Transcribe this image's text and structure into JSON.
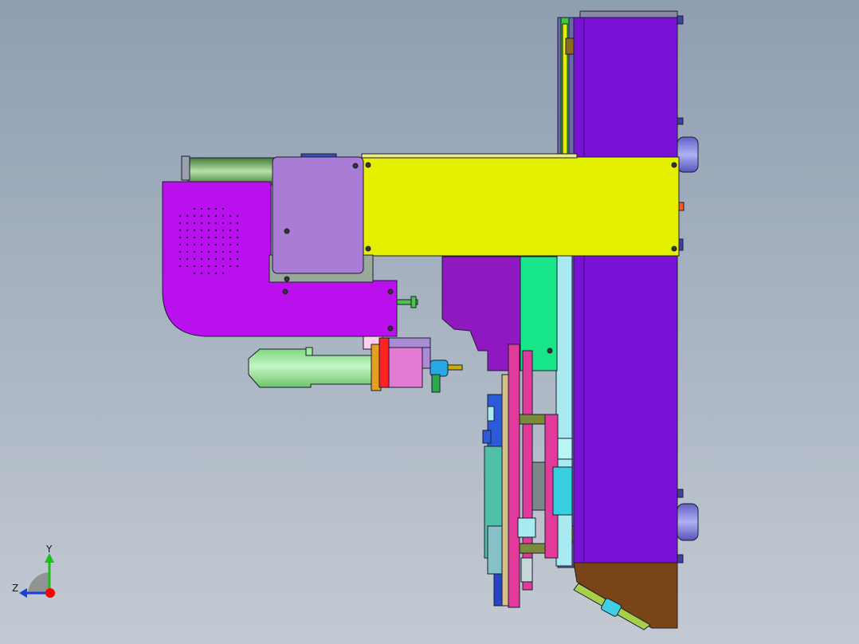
{
  "scene": {
    "background_top": "#8e9eb1",
    "background_bottom": "#c3cad3",
    "outline_color": "#1c1c30"
  },
  "parts": {
    "frame_color": "#7a12d6",
    "base_color": "#7a4516",
    "arm_color": "#e4f000",
    "head_color": "#bb10ee",
    "motor_color": "#a97cd6",
    "barrel_color": "#9cec9c",
    "green_plate_color": "#18e68a",
    "pink_plate_color": "#e23a9a",
    "cyan_color": "#a8eaf0",
    "blue_knob_color": "#8585e0",
    "red_color": "#ff2222"
  },
  "triad": {
    "y_label": "Y",
    "z_label": "Z",
    "y_color": "#18c018",
    "z_color": "#1a3ed8",
    "origin_color": "#ff0000"
  }
}
